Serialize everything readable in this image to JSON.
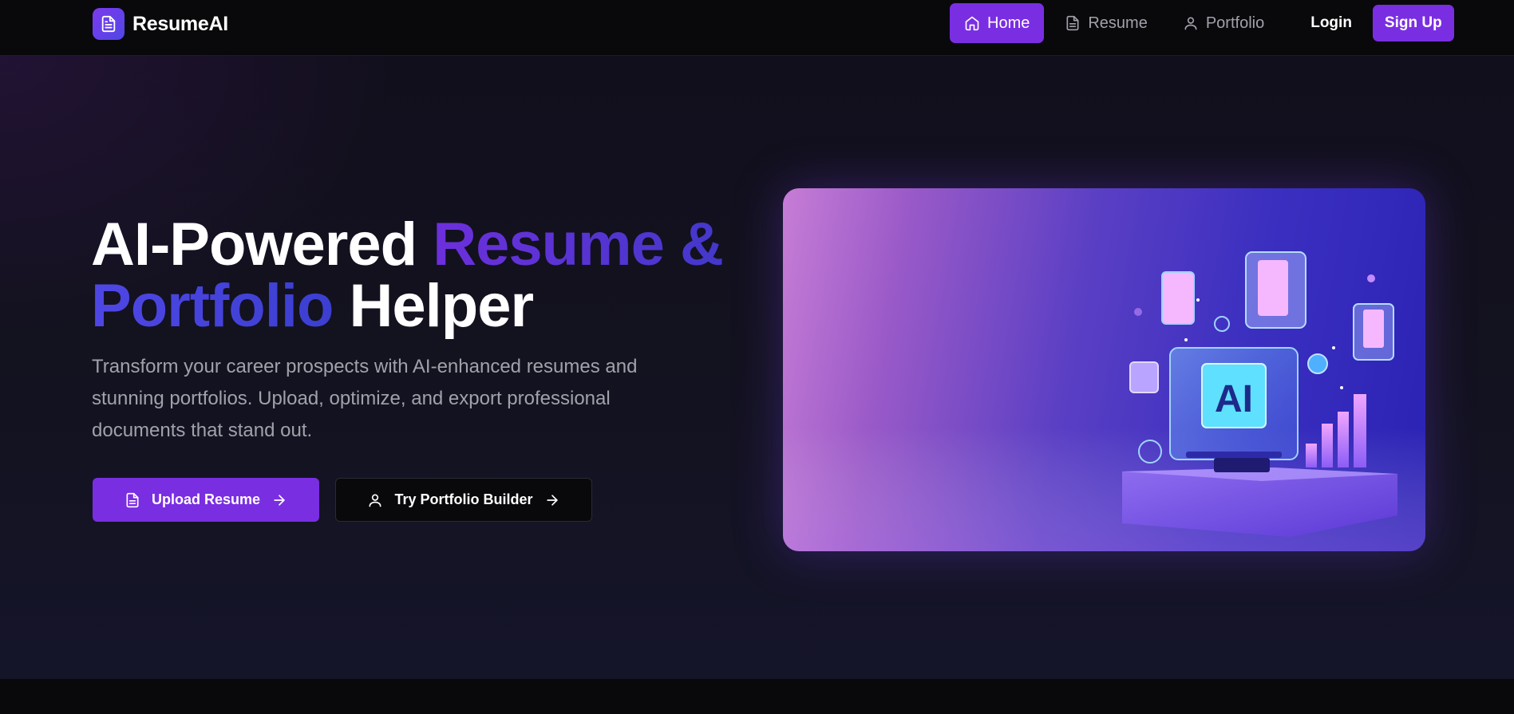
{
  "brand": {
    "name": "ResumeAI",
    "logo_icon": "document-icon"
  },
  "nav": {
    "items": [
      {
        "label": "Home",
        "icon": "home-icon",
        "active": true
      },
      {
        "label": "Resume",
        "icon": "document-icon",
        "active": false
      },
      {
        "label": "Portfolio",
        "icon": "user-icon",
        "active": false
      }
    ],
    "login_label": "Login",
    "signup_label": "Sign Up"
  },
  "hero": {
    "headline_part1": "AI-Powered ",
    "headline_highlight1": "Resume &",
    "headline_highlight2": "Portfolio",
    "headline_part2": " Helper",
    "description": "Transform your career prospects with AI-enhanced resumes and stunning portfolios. Upload, optimize, and export professional documents that stand out.",
    "primary_button": "Upload Resume",
    "secondary_button": "Try Portfolio Builder",
    "illustration_text": "AI"
  },
  "colors": {
    "accent": "#7a2ee2",
    "background": "#13121f",
    "navbar": "#09090b",
    "muted_text": "#a1a1aa"
  }
}
